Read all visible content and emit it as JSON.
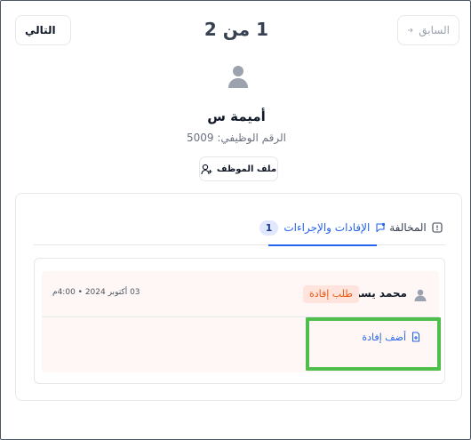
{
  "pagination": {
    "next_label": "التالي",
    "prev_label": "السابق",
    "counter": "1 من 2"
  },
  "employee": {
    "name": "أميمة س",
    "id_text": "الرقم الوظيفي: 5009",
    "profile_button": "ملف الموظف"
  },
  "tabs": {
    "actions_label": "الإفادات والإجراءات",
    "actions_count": "1",
    "violation_label": "المخالفة"
  },
  "entry": {
    "user_name": "محمد يسري",
    "badge": "طلب إفادة",
    "date": "03 أكتوبر 2024 • 4:00م",
    "add_label": "أضف إفادة"
  },
  "colors": {
    "accent": "#2563eb",
    "badge_text": "#ea580c",
    "badge_bg": "#ffe4de",
    "entry_bg": "#fff7f5",
    "highlight": "#4fbe4a"
  },
  "icons": {
    "next": "arrow-left-icon",
    "prev": "arrow-right-icon",
    "avatar": "user-icon",
    "profile": "user-plus-icon",
    "actions_tab": "chat-icon",
    "violation_tab": "alert-square-icon",
    "add": "document-plus-icon"
  }
}
